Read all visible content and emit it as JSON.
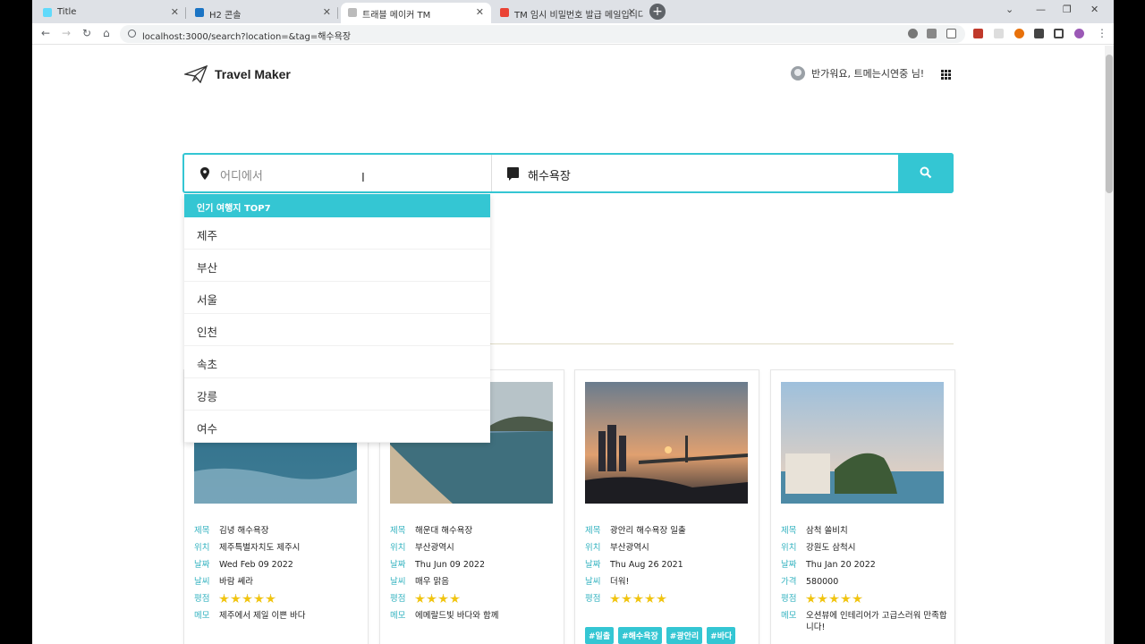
{
  "tabs": [
    {
      "label": "Title"
    },
    {
      "label": "H2 콘솔"
    },
    {
      "label": "트래블 메이커 TM"
    },
    {
      "label": "TM 임시 비밀번호 발급 메일입니다"
    }
  ],
  "address": {
    "url": "localhost:3000/search?location=&tag=해수욕장"
  },
  "header": {
    "logo_text": "Travel Maker",
    "greeting": "반가워요, 트메는시연중 님!"
  },
  "search": {
    "location_placeholder": "어디에서",
    "tag_value": "해수욕장"
  },
  "dropdown": {
    "heading": "인기 여행지 TOP7",
    "items": [
      "제주",
      "부산",
      "서울",
      "인천",
      "속초",
      "강릉",
      "여수"
    ]
  },
  "cards": [
    {
      "rows": [
        {
          "k": "제목",
          "v": "김녕 해수욕장"
        },
        {
          "k": "위치",
          "v": "제주특별자치도 제주시"
        },
        {
          "k": "날짜",
          "v": "Wed Feb 09 2022"
        },
        {
          "k": "날씨",
          "v": "바람 쎄라"
        }
      ],
      "rating_label": "평점",
      "rating": 5,
      "memo_k": "메모",
      "memo": "제주에서 제일 이쁜 바다",
      "tags": []
    },
    {
      "rows": [
        {
          "k": "제목",
          "v": "해운대 해수욕장"
        },
        {
          "k": "위치",
          "v": "부산광역시"
        },
        {
          "k": "날짜",
          "v": "Thu Jun 09 2022"
        },
        {
          "k": "날씨",
          "v": "매우 맑음"
        }
      ],
      "rating_label": "평점",
      "rating": 4,
      "memo_k": "메모",
      "memo": "에메랄드빛 바다와 함께",
      "tags": []
    },
    {
      "rows": [
        {
          "k": "제목",
          "v": "광안리 해수욕장 일출"
        },
        {
          "k": "위치",
          "v": "부산광역시"
        },
        {
          "k": "날짜",
          "v": "Thu Aug 26 2021"
        },
        {
          "k": "날씨",
          "v": "더워!"
        }
      ],
      "rating_label": "평점",
      "rating": 5,
      "memo_k": "",
      "memo": "",
      "tags": [
        "#일출",
        "#해수욕장",
        "#광안리",
        "#바다"
      ]
    },
    {
      "rows": [
        {
          "k": "제목",
          "v": "삼척 쏠비치"
        },
        {
          "k": "위치",
          "v": "강원도 삼척시"
        },
        {
          "k": "날짜",
          "v": "Thu Jan 20 2022"
        },
        {
          "k": "가격",
          "v": "580000"
        }
      ],
      "rating_label": "평점",
      "rating": 5,
      "memo_k": "메모",
      "memo": "오션뷰에 인테리어가 고급스러워 만족합니다!",
      "tags": []
    }
  ]
}
